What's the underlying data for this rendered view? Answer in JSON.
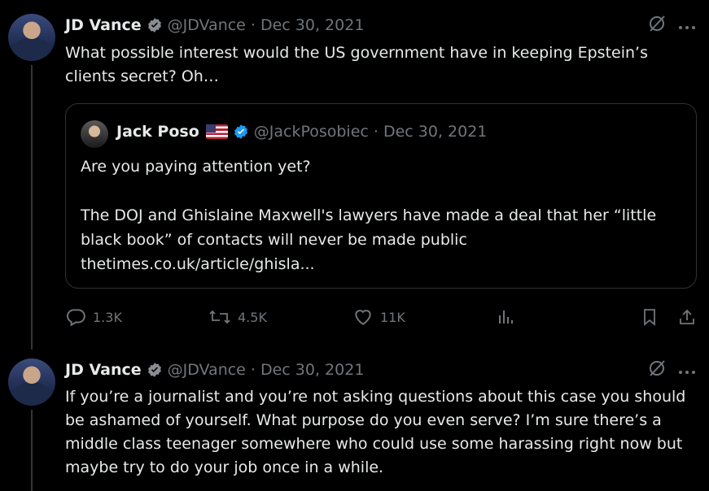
{
  "tweet1": {
    "name": "JD Vance",
    "handle_date": "@JDVance · Dec 30, 2021",
    "text": "What possible interest would the US government have in keeping Epstein’s clients secret? Oh…",
    "quote": {
      "name": "Jack Poso",
      "handle_date": "@JackPosobiec · Dec 30, 2021",
      "text": "Are you paying attention yet?\n\nThe DOJ and Ghislaine Maxwell's lawyers have made a deal that her “little black book” of contacts will never be made public\nthetimes.co.uk/article/ghisla..."
    },
    "actions": {
      "replies": "1.3K",
      "reposts": "4.5K",
      "likes": "11K"
    }
  },
  "tweet2": {
    "name": "JD Vance",
    "handle_date": "@JDVance · Dec 30, 2021",
    "text": "If you’re a journalist and you’re not asking questions about this case you should be ashamed of yourself. What purpose do you even serve? I’m sure there’s a middle class teenager somewhere who could use some harassing right now but maybe try to do your job once in a while."
  },
  "colors": {
    "background": "#000000",
    "text": "#e7e9ea",
    "muted": "#71767b",
    "verified_blue": "#1d9bf0",
    "verified_gold": "#8a8d91"
  }
}
